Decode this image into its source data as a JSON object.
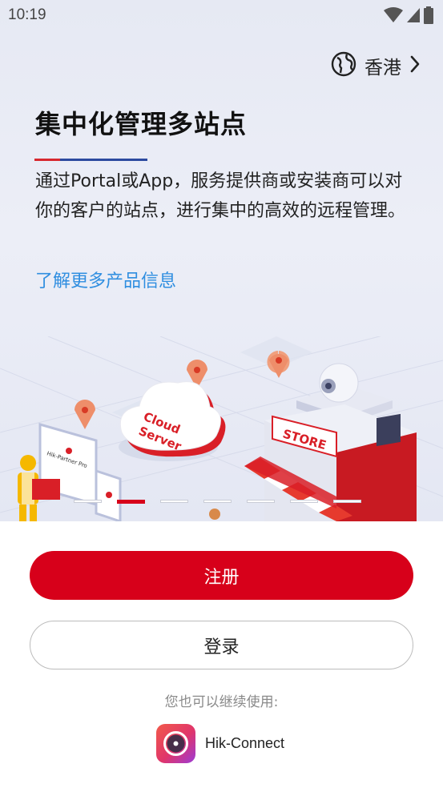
{
  "status_bar": {
    "time": "10:19"
  },
  "region": {
    "label": "香港"
  },
  "hero": {
    "title": "集中化管理多站点",
    "description": "通过Portal或App，服务提供商或安装商可以对你的客户的站点，进行集中的高效的远程管理。",
    "learn_more": "了解更多产品信息",
    "illustration": {
      "cloud_label_1": "Cloud",
      "cloud_label_2": "Server",
      "store_label": "STORE",
      "device_label": "Hik-Partner Pro"
    },
    "carousel": {
      "count": 7,
      "active_index": 1
    }
  },
  "actions": {
    "register_label": "注册",
    "login_label": "登录"
  },
  "alternative": {
    "prompt": "您也可以继续使用:",
    "app_name": "Hik-Connect"
  },
  "colors": {
    "brand_red": "#d7001a",
    "link_blue": "#2f8ee0",
    "underline_red": "#d7282f",
    "underline_blue": "#2c4aa0"
  }
}
